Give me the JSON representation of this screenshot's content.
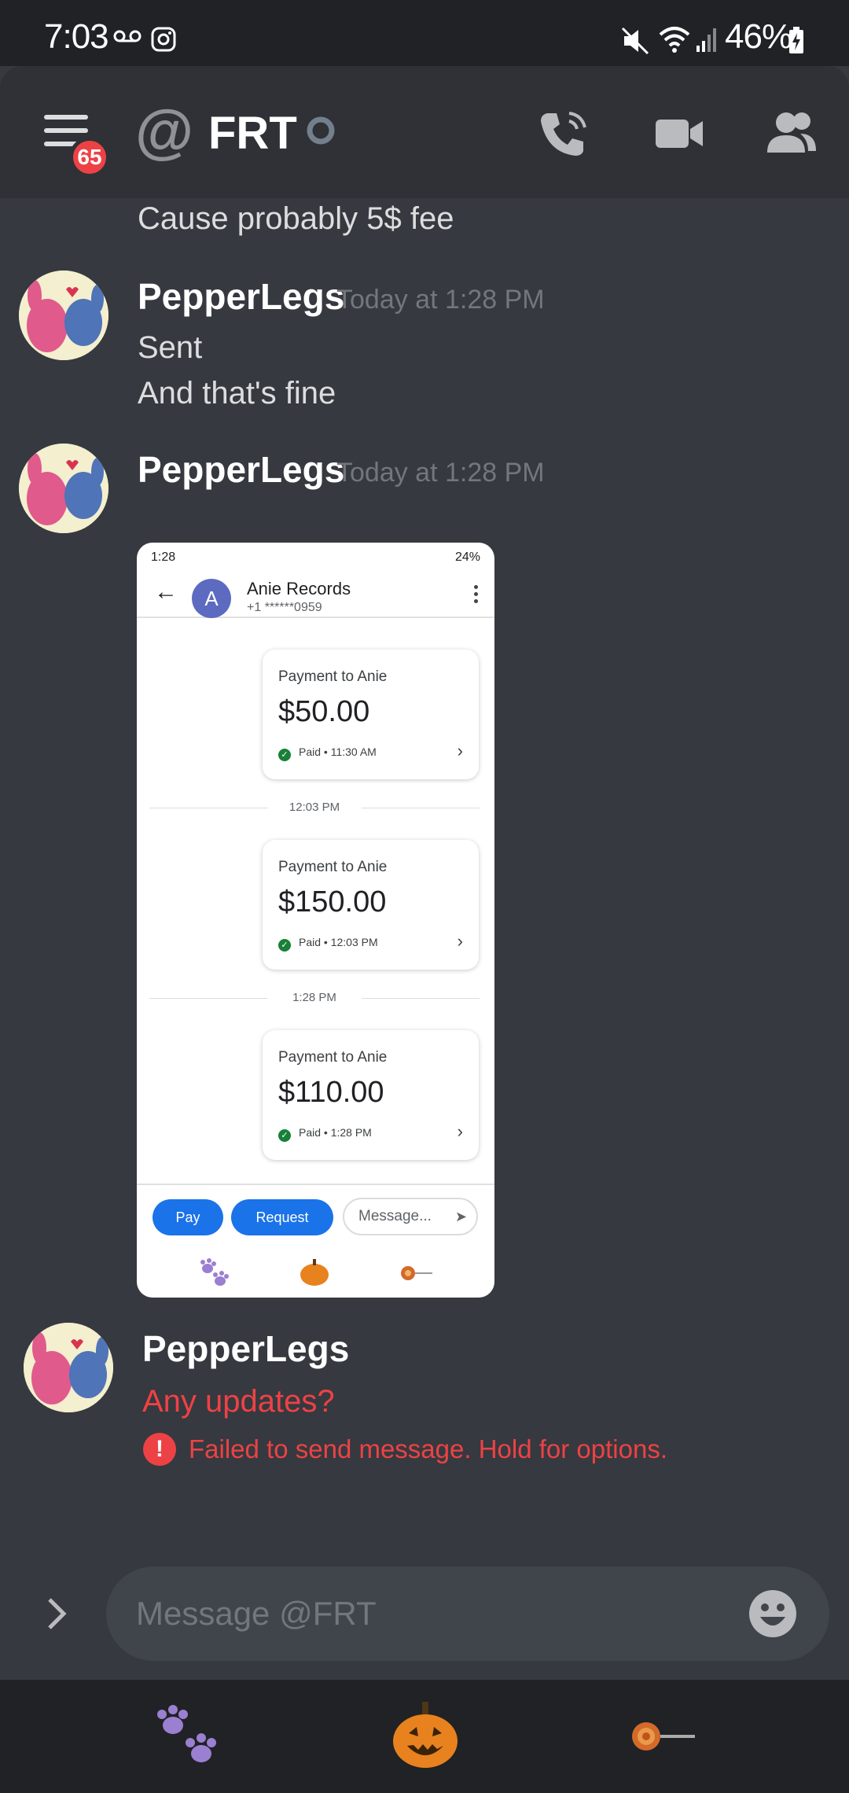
{
  "status_bar": {
    "time": "7:03",
    "battery": "46%"
  },
  "header": {
    "at_symbol": "@",
    "title": "FRT",
    "unread_badge": "65"
  },
  "messages": {
    "continued_text": "Cause probably 5$ fee",
    "group1": {
      "author": "PepperLegs",
      "timestamp": "Today at 1:28 PM",
      "lines": [
        "Sent",
        "And that's fine"
      ]
    },
    "group2": {
      "author": "PepperLegs",
      "timestamp": "Today at 1:28 PM"
    },
    "group3": {
      "author": "PepperLegs",
      "text": "Any updates?",
      "error": "Failed to send message. Hold for options."
    }
  },
  "attachment": {
    "status_time": "1:28",
    "status_battery": "24%",
    "contact_initial": "A",
    "contact_name": "Anie Records",
    "contact_number": "+1 ******0959",
    "payments": [
      {
        "title": "Payment to Anie",
        "amount": "$50.00",
        "status": "Paid • 11:30 AM"
      },
      {
        "title": "Payment to Anie",
        "amount": "$150.00",
        "status": "Paid • 12:03 PM"
      },
      {
        "title": "Payment to Anie",
        "amount": "$110.00",
        "status": "Paid • 1:28 PM"
      }
    ],
    "separators": [
      "12:03 PM",
      "1:28 PM"
    ],
    "pay_label": "Pay",
    "request_label": "Request",
    "message_placeholder": "Message..."
  },
  "composer": {
    "placeholder": "Message @FRT"
  },
  "colors": {
    "background": "#36393f",
    "header": "#2f3136",
    "error": "#ed4245",
    "gpay_blue": "#1a73e8",
    "paid_green": "#188038"
  }
}
